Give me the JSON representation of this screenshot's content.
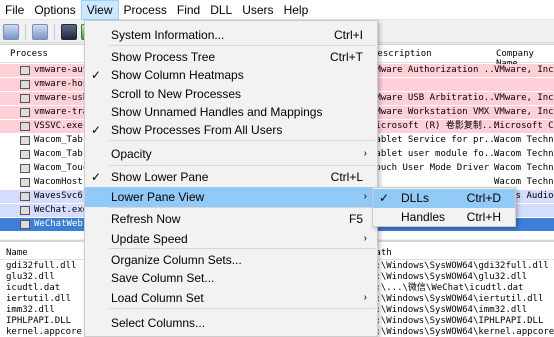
{
  "menubar": [
    "File",
    "Options",
    "View",
    "Process",
    "Find",
    "DLL",
    "Users",
    "Help"
  ],
  "upper": {
    "headers": {
      "process": "Process",
      "description": "Description",
      "company": "Company Name"
    },
    "rows": [
      {
        "name": "vmware-aut",
        "desc": "VMware Authorization ...",
        "comp": "VMware, Inc.",
        "bg": "#ffd0d8"
      },
      {
        "name": "vmware-hos",
        "desc": "",
        "comp": "",
        "bg": "#ffd0d8"
      },
      {
        "name": "vmware-usb",
        "desc": "VMware USB Arbitratio...",
        "comp": "VMware, Inc.",
        "bg": "#ffd0d8"
      },
      {
        "name": "vmware-tra",
        "desc": "VMware Workstation VMX",
        "comp": "VMware, Inc.",
        "bg": "#ffd0d8"
      },
      {
        "name": "VSSVC.exe",
        "desc": "Microsoft (R) 卷影复制...",
        "comp": "Microsoft Co",
        "bg": "#ffd0d8"
      },
      {
        "name": "Wacom_Tab",
        "desc": "Tablet Service for pr...",
        "comp": "Wacom Techno",
        "bg": "#ffffff"
      },
      {
        "name": "Wacom_Tab",
        "desc": "Tablet user module fo...",
        "comp": "Wacom Techno",
        "bg": "#ffffff"
      },
      {
        "name": "Wacom_Touc",
        "desc": "Touch User Mode Driver",
        "comp": "Wacom Techno",
        "bg": "#ffffff"
      },
      {
        "name": "WacomHost.",
        "desc": "",
        "comp": "Wacom Techno",
        "bg": "#ffffff"
      },
      {
        "name": "WavesSvc6",
        "desc": "",
        "comp": "Waves Audio",
        "bg": "#d4ddff"
      },
      {
        "name": "WeChat.exe",
        "desc": "",
        "comp": "",
        "bg": "#d4ddff"
      },
      {
        "name": "WeChatWeb",
        "desc": "",
        "comp": "",
        "bg": "#3d7fd6"
      }
    ]
  },
  "lower": {
    "headers": {
      "name": "Name",
      "path": "Path"
    },
    "rows": [
      {
        "name": "gdi32full.dll",
        "path": "C:\\Windows\\SysWOW64\\gdi32full.dll"
      },
      {
        "name": "glu32.dll",
        "path": "C:\\Windows\\SysWOW64\\glu32.dll"
      },
      {
        "name": "icudtl.dat",
        "path": "C:\\...\\微信\\WeChat\\icudtl.dat"
      },
      {
        "name": "iertutil.dll",
        "path": "C:\\Windows\\SysWOW64\\iertutil.dll"
      },
      {
        "name": "imm32.dll",
        "path": "C:\\Windows\\SysWOW64\\imm32.dll"
      },
      {
        "name": "IPHLPAPI.DLL",
        "path": "C:\\Windows\\SysWOW64\\IPHLPAPI.DLL"
      },
      {
        "name": "kernel.appcore.dll",
        "path": "C:\\Windows\\SysWOW64\\kernel.appcore.dll"
      }
    ]
  },
  "view_menu": {
    "items": [
      {
        "label": "System Information...",
        "shortcut": "Ctrl+I"
      },
      {
        "label": "Show Process Tree",
        "shortcut": "Ctrl+T"
      },
      {
        "label": "Show Column Heatmaps",
        "checked": true
      },
      {
        "label": "Scroll to New Processes"
      },
      {
        "label": "Show Unnamed Handles and Mappings"
      },
      {
        "label": "Show Processes From All Users",
        "checked": true
      },
      {
        "label": "Opacity",
        "submenu": true
      },
      {
        "label": "Show Lower Pane",
        "shortcut": "Ctrl+L",
        "checked": true
      },
      {
        "label": "Lower Pane View",
        "submenu": true,
        "highlighted": true
      },
      {
        "label": "Refresh Now",
        "shortcut": "F5"
      },
      {
        "label": "Update Speed",
        "submenu": true
      },
      {
        "label": "Organize Column Sets..."
      },
      {
        "label": "Save Column Set..."
      },
      {
        "label": "Load Column Set",
        "submenu": true
      },
      {
        "label": "Select Columns..."
      }
    ]
  },
  "lower_pane_submenu": {
    "items": [
      {
        "label": "DLLs",
        "shortcut": "Ctrl+D",
        "checked": true
      },
      {
        "label": "Handles",
        "shortcut": "Ctrl+H"
      }
    ]
  },
  "glyphs": {
    "check": "✓",
    "arrow": "›"
  }
}
